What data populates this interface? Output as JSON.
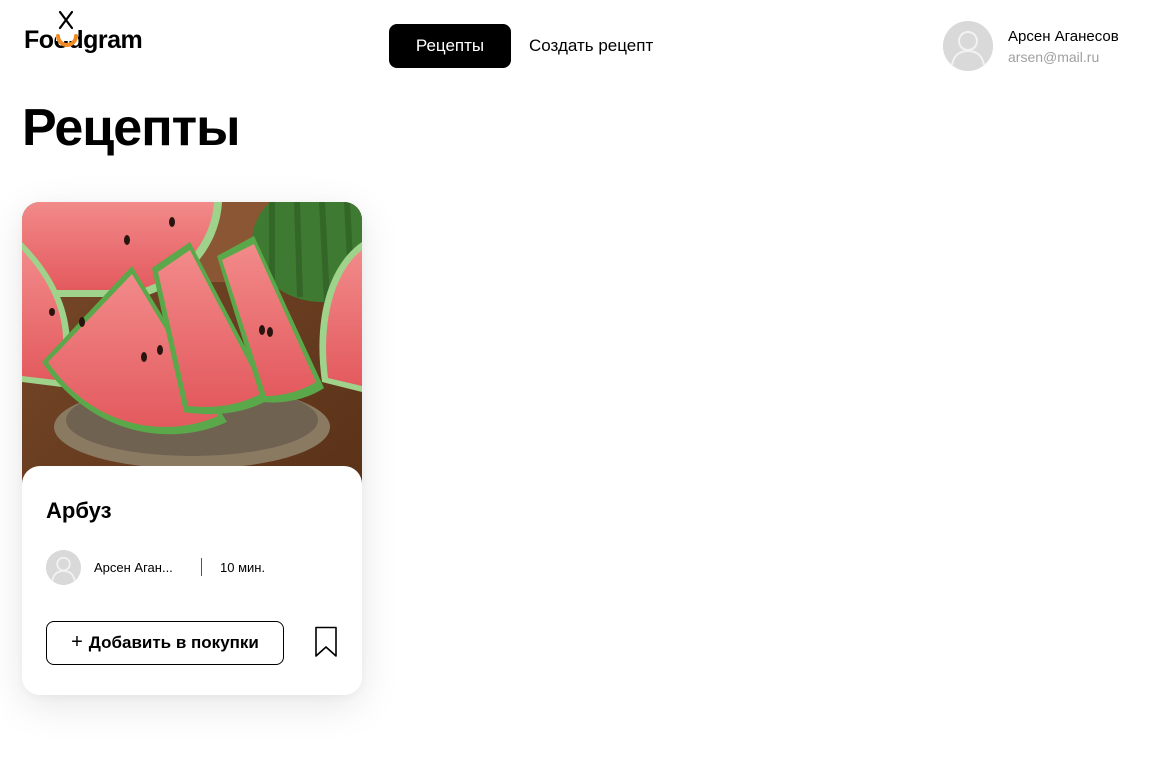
{
  "header": {
    "logo_text": "Foodgram",
    "nav": {
      "recipes_label": "Рецепты",
      "create_label": "Создать рецепт"
    },
    "user": {
      "name": "Арсен Аганесов",
      "email": "arsen@mail.ru",
      "avatar_icon": "user-placeholder-icon"
    }
  },
  "main": {
    "title": "Рецепты",
    "recipes": [
      {
        "title": "Арбуз",
        "image_icon": "watermason-photo",
        "author": "Арсен Аган...",
        "cook_time": "10 мин.",
        "add_to_cart_label": "Добавить в покупки",
        "plus_icon": "+",
        "bookmark_icon": "bookmark-icon"
      }
    ]
  },
  "colors": {
    "accent": "#000000",
    "logo_accent": "#f08a24",
    "avatar_bg": "#d9d9d9",
    "muted_text": "#a0a0a0"
  }
}
